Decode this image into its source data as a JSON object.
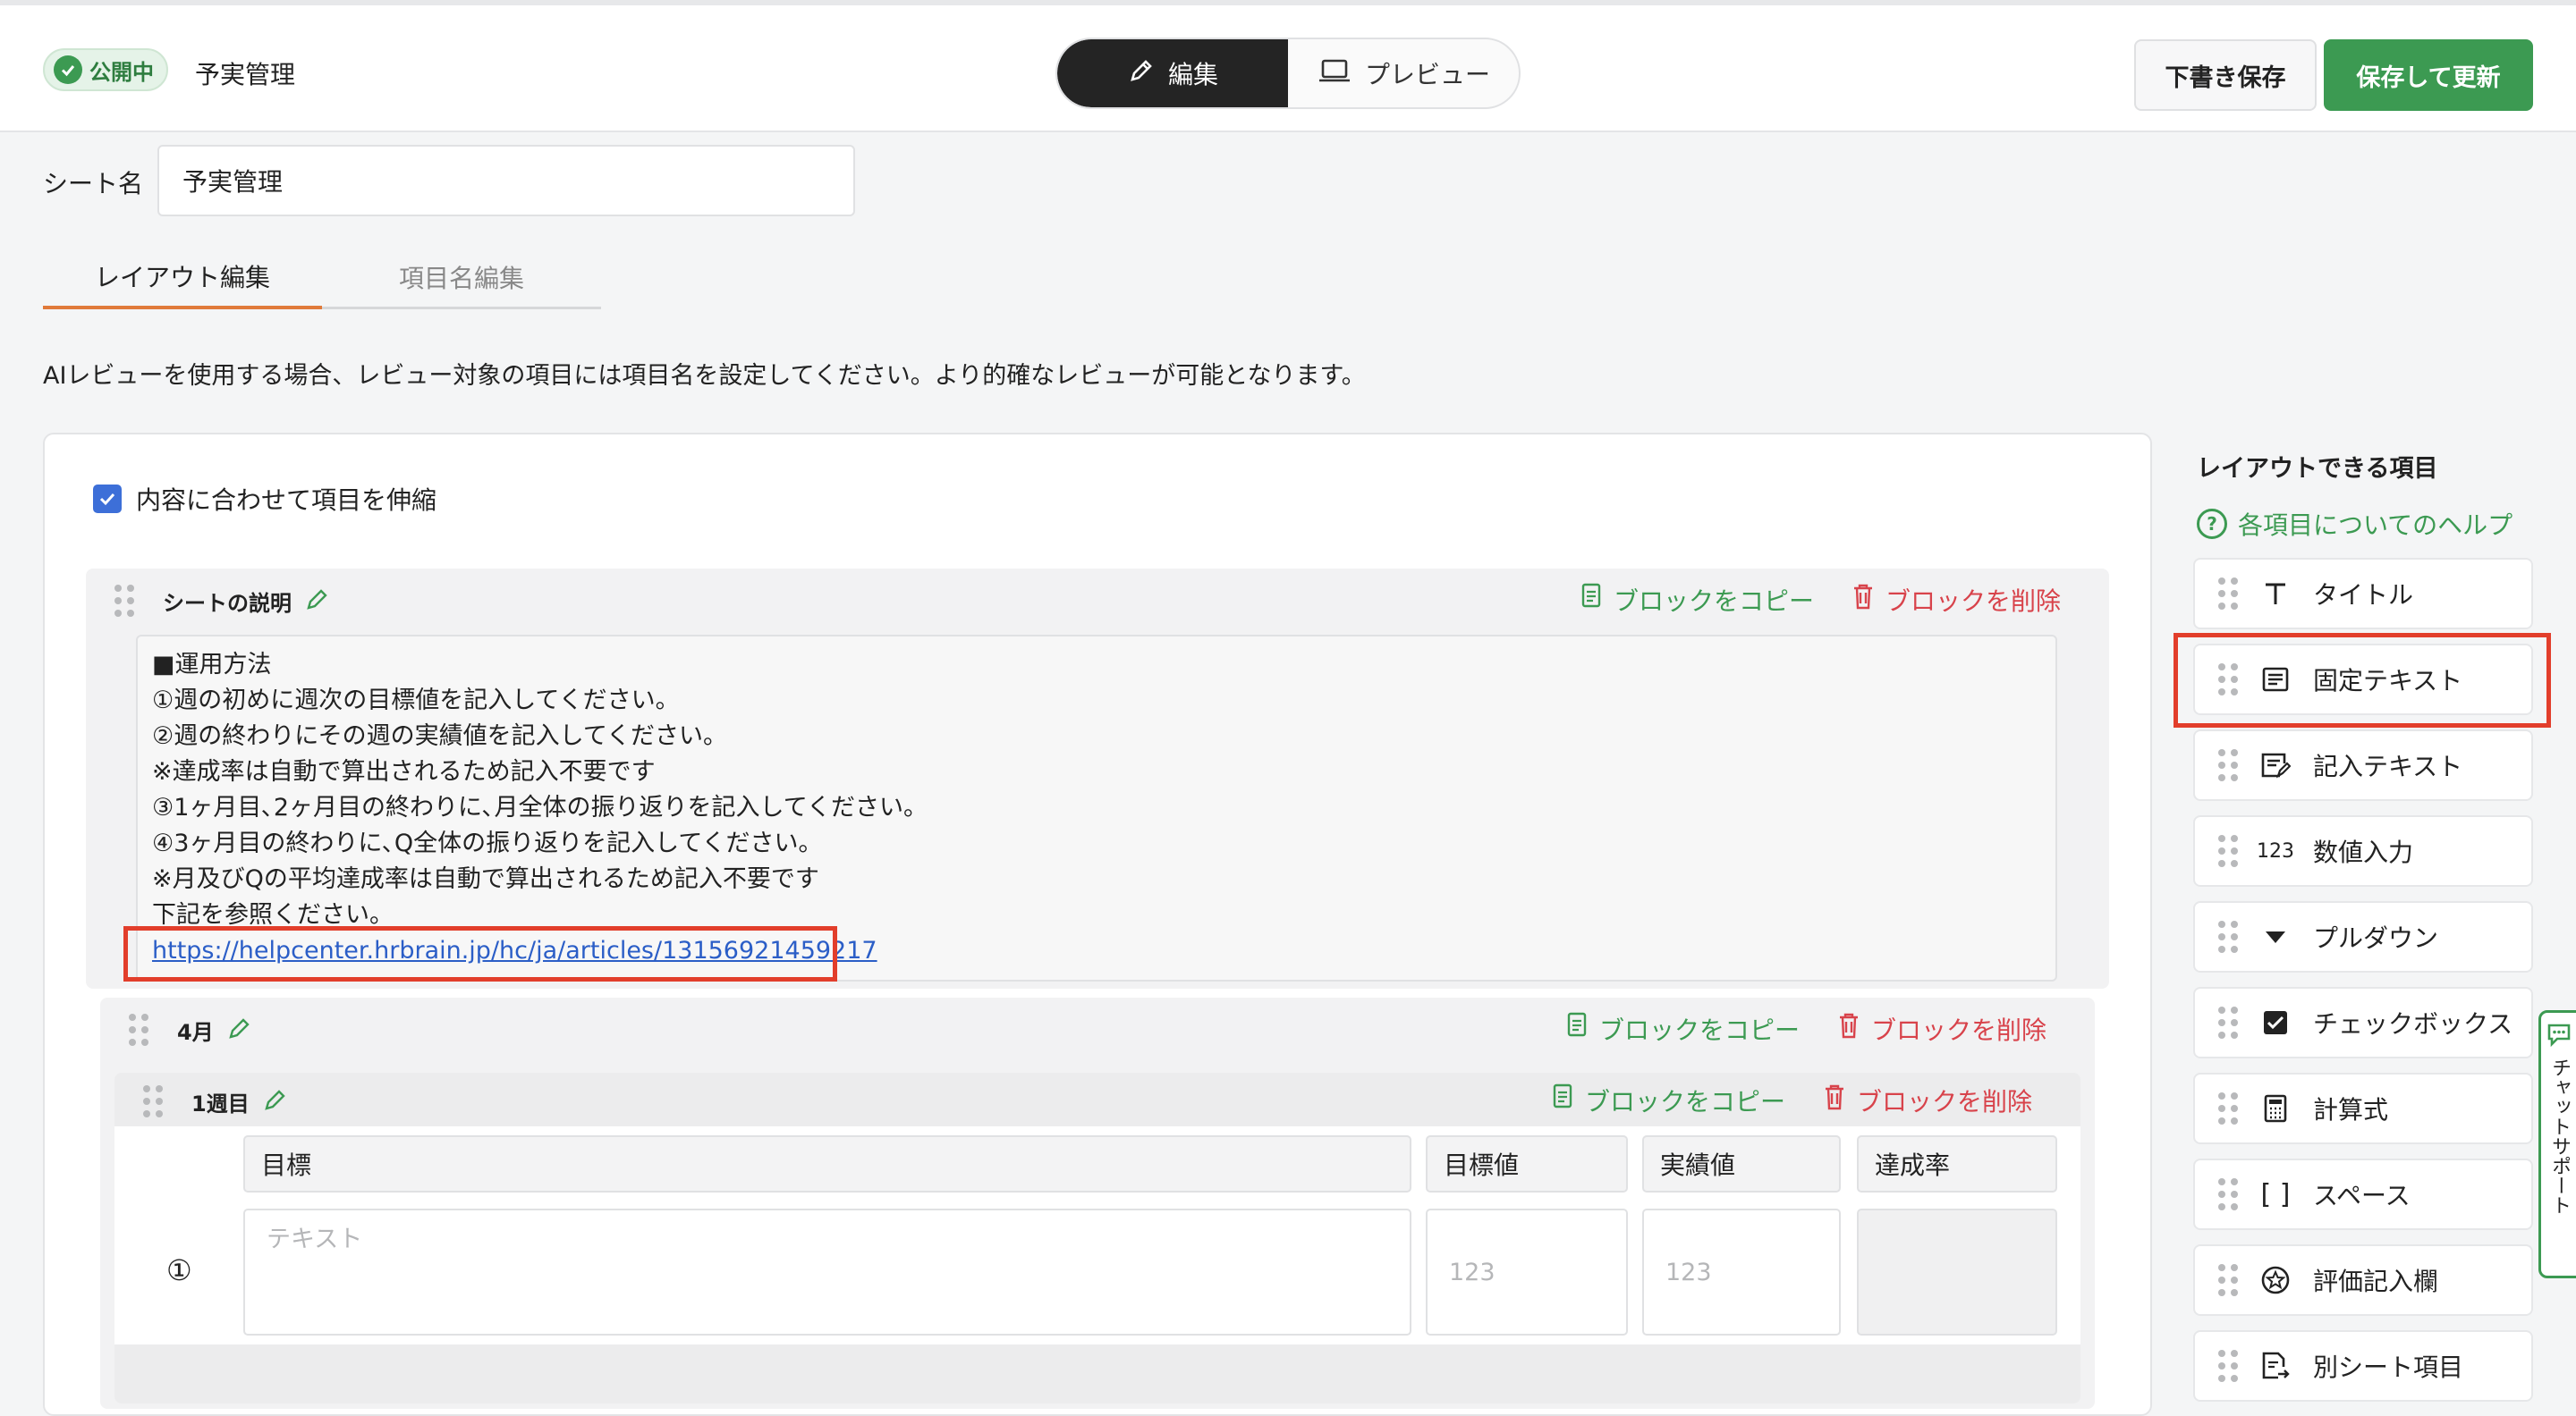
{
  "header": {
    "status_badge": "公開中",
    "sheet_title": "予実管理",
    "mode_edit": "編集",
    "mode_preview": "プレビュー",
    "draft_save": "下書き保存",
    "save_update": "保存して更新"
  },
  "sheet_name": {
    "label": "シート名",
    "value": "予実管理"
  },
  "tabs": [
    {
      "label": "レイアウト編集"
    },
    {
      "label": "項目名編集"
    }
  ],
  "notice": "AIレビューを使用する場合、レビュー対象の項目には項目名を設定してください。より的確なレビューが可能となります。",
  "canvas": {
    "fit_checkbox_label": "内容に合わせて項目を伸縮",
    "copy_block": "ブロックをコピー",
    "delete_block": "ブロックを削除",
    "description_block": {
      "title": "シートの説明",
      "lines": [
        "■運用方法",
        "①週の初めに週次の目標値を記入してください。",
        "②週の終わりにその週の実績値を記入してください。",
        "※達成率は自動で算出されるため記入不要です",
        "③1ヶ月目､2ヶ月目の終わりに､月全体の振り返りを記入してください。",
        "④3ヶ月目の終わりに､Q全体の振り返りを記入してください。",
        "※月及びQの平均達成率は自動で算出されるため記入不要です",
        "下記を参照ください。"
      ],
      "link": "https://helpcenter.hrbrain.jp/hc/ja/articles/13156921459217"
    },
    "month_block": {
      "title": "4月"
    },
    "week_block": {
      "title": "1週目",
      "columns": [
        "目標",
        "目標値",
        "実績値",
        "達成率"
      ],
      "row_label": "①",
      "placeholders": {
        "text": "テキスト",
        "target": "123",
        "actual": "123"
      }
    }
  },
  "sidebar": {
    "title": "レイアウトできる項目",
    "help": "各項目についてのヘルプ",
    "items": [
      {
        "label": "タイトル",
        "icon": "title-icon"
      },
      {
        "label": "固定テキスト",
        "icon": "fixed-text-icon"
      },
      {
        "label": "記入テキスト",
        "icon": "input-text-icon"
      },
      {
        "label": "数値入力",
        "icon": "number-icon",
        "icon_text": "123"
      },
      {
        "label": "プルダウン",
        "icon": "dropdown-icon"
      },
      {
        "label": "チェックボックス",
        "icon": "checkbox-icon"
      },
      {
        "label": "計算式",
        "icon": "calculator-icon"
      },
      {
        "label": "スペース",
        "icon": "space-icon",
        "icon_text": "[ ]"
      },
      {
        "label": "評価記入欄",
        "icon": "rating-icon"
      },
      {
        "label": "別シート項目",
        "icon": "other-sheet-icon"
      }
    ]
  },
  "chat_support": "チャットサポート",
  "colors": {
    "accent_green": "#3c9a52",
    "danger_red": "#d8434b",
    "highlight_red": "#e23e2b",
    "link_blue": "#2b5ec7",
    "tab_orange": "#e07a3a"
  }
}
